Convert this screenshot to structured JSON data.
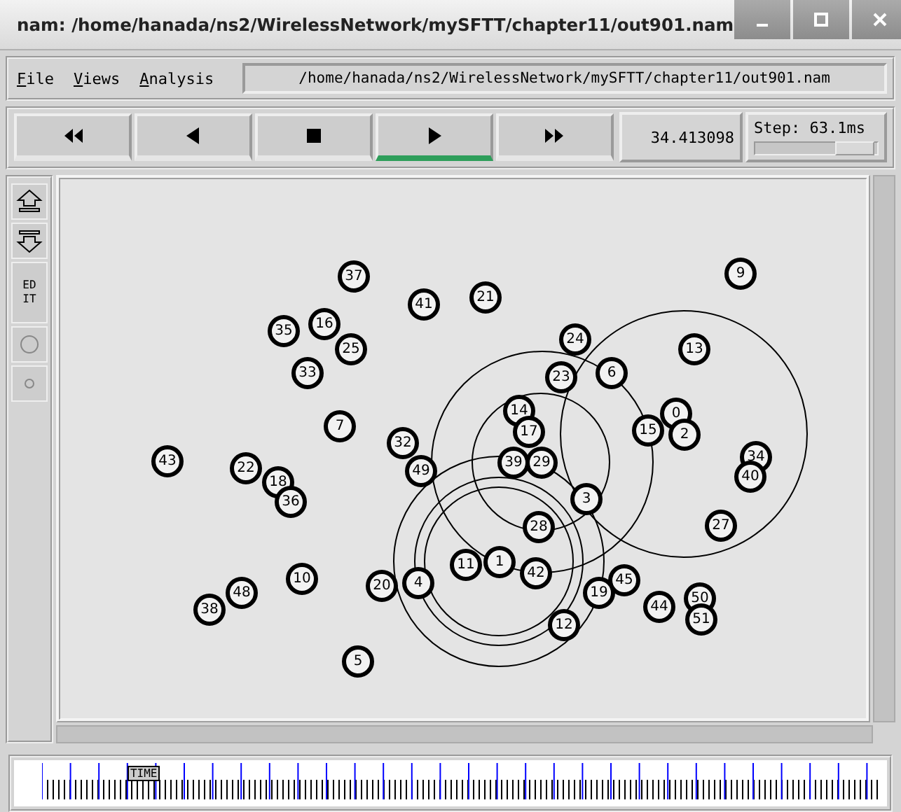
{
  "window": {
    "title": "nam: /home/hanada/ns2/WirelessNetwork/mySFTT/chapter11/out901.nam"
  },
  "menu": [
    "File",
    "Views",
    "Analysis"
  ],
  "file_path": "/home/hanada/ns2/WirelessNetwork/mySFTT/chapter11/out901.nam",
  "playback_buttons": [
    {
      "kind": "rewind",
      "selected": false
    },
    {
      "kind": "back",
      "selected": false
    },
    {
      "kind": "stop",
      "selected": false
    },
    {
      "kind": "play",
      "selected": true
    },
    {
      "kind": "forward",
      "selected": false
    }
  ],
  "time": "34.413098",
  "step": {
    "label": "Step: 63.1ms",
    "level": 0.8
  },
  "tools": [
    {
      "kind": "zoom-in"
    },
    {
      "kind": "zoom-out"
    },
    {
      "kind": "edit",
      "label": "EDIT"
    },
    {
      "kind": "big-node"
    },
    {
      "kind": "small-node"
    }
  ],
  "nodes": [
    {
      "label": "37"
    },
    {
      "label": "41"
    },
    {
      "label": "21"
    },
    {
      "label": "9"
    },
    {
      "label": "35"
    },
    {
      "label": "16"
    },
    {
      "label": "25"
    },
    {
      "label": "33"
    },
    {
      "label": "24"
    },
    {
      "label": "13"
    },
    {
      "label": "23"
    },
    {
      "label": "6"
    },
    {
      "label": "7"
    },
    {
      "label": "14"
    },
    {
      "label": "17"
    },
    {
      "label": "15"
    },
    {
      "label": "0"
    },
    {
      "label": "2"
    },
    {
      "label": "32"
    },
    {
      "label": "43"
    },
    {
      "label": "22"
    },
    {
      "label": "49"
    },
    {
      "label": "39"
    },
    {
      "label": "29"
    },
    {
      "label": "34"
    },
    {
      "label": "40"
    },
    {
      "label": "18"
    },
    {
      "label": "36"
    },
    {
      "label": "3"
    },
    {
      "label": "28"
    },
    {
      "label": "27"
    },
    {
      "label": "11"
    },
    {
      "label": "1"
    },
    {
      "label": "42"
    },
    {
      "label": "10"
    },
    {
      "label": "20"
    },
    {
      "label": "4"
    },
    {
      "label": "45"
    },
    {
      "label": "19"
    },
    {
      "label": "38"
    },
    {
      "label": "48"
    },
    {
      "label": "44"
    },
    {
      "label": "50"
    },
    {
      "label": "51"
    },
    {
      "label": "12"
    },
    {
      "label": "5"
    }
  ],
  "timeline": {
    "marker": "TIME",
    "level": 0.13
  }
}
